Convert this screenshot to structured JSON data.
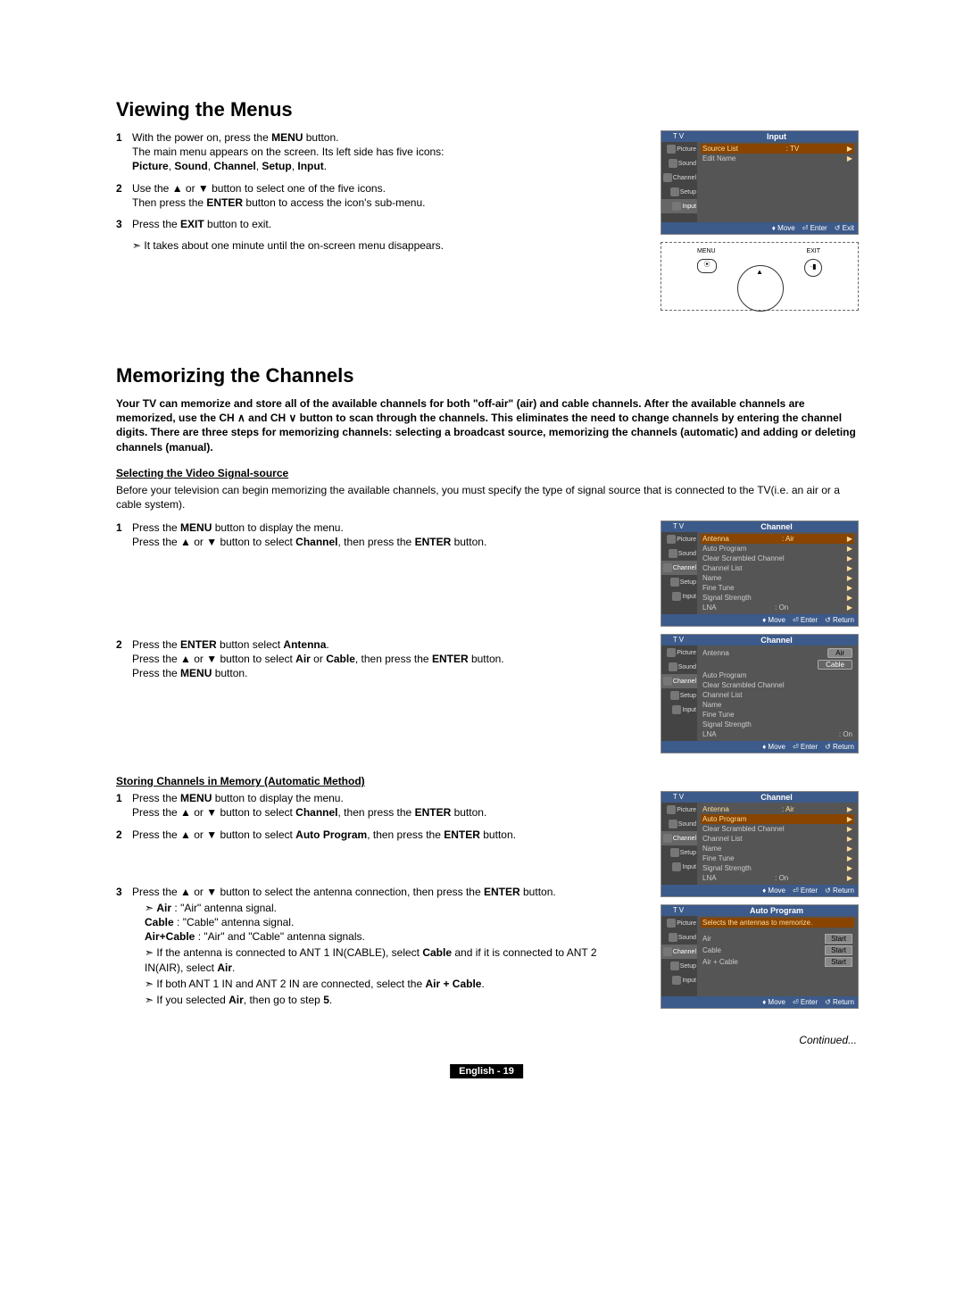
{
  "headings": {
    "h1a": "Viewing the Menus",
    "h1b": "Memorizing the Channels"
  },
  "section1": {
    "step1_a": "With the power on, press the ",
    "step1_b": "MENU",
    "step1_c": " button.",
    "step1_d": "The main menu appears on the screen. Its left side has five icons:",
    "step1_e": "Picture",
    "step1_f": ", ",
    "step1_g": "Sound",
    "step1_h": "Channel",
    "step1_i": "Setup",
    "step1_j": "Input",
    "step1_k": ".",
    "step2_a": "Use the ▲ or ▼ button to select one of the five icons.",
    "step2_b": "Then press the ",
    "step2_c": "ENTER",
    "step2_d": " button to access the icon's sub-menu.",
    "step3_a": "Press the ",
    "step3_b": "EXIT",
    "step3_c": " button to exit.",
    "note1": "It takes about one minute until the on-screen menu disappears."
  },
  "section2": {
    "intro_a": "Your TV can memorize and store all of the available channels for both \"off-air\" (air) and cable channels. After the available channels are memorized, use the CH ",
    "intro_b": " and CH ",
    "intro_c": " button to scan through the channels. This eliminates the need to change channels by entering the channel digits. There are three steps for memorizing channels: selecting a broadcast source, memorizing the channels (automatic) and adding or deleting channels (manual).",
    "sub_h1": "Selecting the Video Signal-source",
    "p1": "Before your television can begin memorizing the available channels, you must specify the type of signal source that is connected to the TV(i.e. an air or a cable system).",
    "s1_a": "Press the ",
    "s1_b": "MENU",
    "s1_c": " button to display the menu.",
    "s1_d": "Press the ▲ or ▼ button to select ",
    "s1_e": "Channel",
    "s1_f": ", then press the ",
    "s1_g": "ENTER",
    "s1_h": " button.",
    "s2_a": "Press the ",
    "s2_b": "ENTER",
    "s2_c": " button select ",
    "s2_d": "Antenna",
    "s2_e": ".",
    "s2_f": "Press the ▲ or ▼ button to select ",
    "s2_g": "Air",
    "s2_h": " or ",
    "s2_i": "Cable",
    "s2_j": ", then press the ",
    "s2_k": "ENTER",
    "s2_l": " button.",
    "s2_m": "Press the ",
    "s2_n": "MENU",
    "s2_o": " button.",
    "sub_h2": "Storing Channels in Memory (Automatic Method)",
    "a1_a": "Press the ",
    "a1_b": "MENU",
    "a1_c": " button to display the menu.",
    "a1_d": "Press the ▲ or ▼ button to select ",
    "a1_e": "Channel",
    "a1_f": ", then press the ",
    "a1_g": "ENTER",
    "a1_h": " button.",
    "a2_a": "Press the ▲ or ▼ button to select ",
    "a2_b": "Auto Program",
    "a2_c": ", then press the ",
    "a2_d": "ENTER",
    "a2_e": " button.",
    "a3_a": "Press the ▲ or ▼ button to select the antenna connection, then press the ",
    "a3_b": "ENTER",
    "a3_c": " button.",
    "n1_a": "Air",
    "n1_b": " : \"Air\" antenna signal.",
    "n1_c": "Cable",
    "n1_d": " : \"Cable\" antenna signal.",
    "n1_e": "Air+Cable",
    "n1_f": " : \"Air\" and \"Cable\" antenna signals.",
    "n2_a": "If the antenna is connected to ANT 1 IN(CABLE), select ",
    "n2_b": "Cable",
    "n2_c": " and if it is connected to ANT 2 IN(AIR), select ",
    "n2_d": "Air",
    "n2_e": ".",
    "n3_a": "If both ANT 1 IN and ANT 2 IN are connected, select the ",
    "n3_b": "Air + Cable",
    "n3_c": ".",
    "n4_a": "If you selected ",
    "n4_b": "Air",
    "n4_c": ", then go to step ",
    "n4_d": "5",
    "n4_e": "."
  },
  "osd": {
    "tv": "T V",
    "sidebar": [
      "Picture",
      "Sound",
      "Channel",
      "Setup",
      "Input"
    ],
    "input": {
      "title": "Input",
      "rows": [
        {
          "l": "Source List",
          "v": ": TV"
        },
        {
          "l": "Edit Name",
          "v": ""
        }
      ]
    },
    "channel": {
      "title": "Channel",
      "rows": [
        {
          "l": "Antenna",
          "v": ": Air"
        },
        {
          "l": "Auto Program",
          "v": ""
        },
        {
          "l": "Clear Scrambled Channel",
          "v": ""
        },
        {
          "l": "Channel List",
          "v": ""
        },
        {
          "l": "Name",
          "v": ""
        },
        {
          "l": "Fine Tune",
          "v": ""
        },
        {
          "l": "Signal Strength",
          "v": ""
        },
        {
          "l": "LNA",
          "v": ": On"
        }
      ]
    },
    "channel2": {
      "title": "Channel",
      "antenna": "Antenna",
      "opts": [
        "Air",
        "Cable"
      ],
      "rows": [
        "Auto Program",
        "Clear Scrambled Channel",
        "Channel List",
        "Name",
        "Fine Tune",
        "Signal Strength",
        "LNA"
      ],
      "lna": ": On"
    },
    "autoprog": {
      "title": "Auto Program",
      "hint": "Selects the antennas to memorize.",
      "rows": [
        "Air",
        "Cable",
        "Air + Cable"
      ],
      "start": "Start"
    },
    "footer": {
      "move": "Move",
      "enter": "Enter",
      "exit": "Exit",
      "return": "Return"
    },
    "remote": {
      "menu": "MENU",
      "exit": "EXIT"
    }
  },
  "foot": {
    "continued": "Continued...",
    "page": "English - 19"
  }
}
